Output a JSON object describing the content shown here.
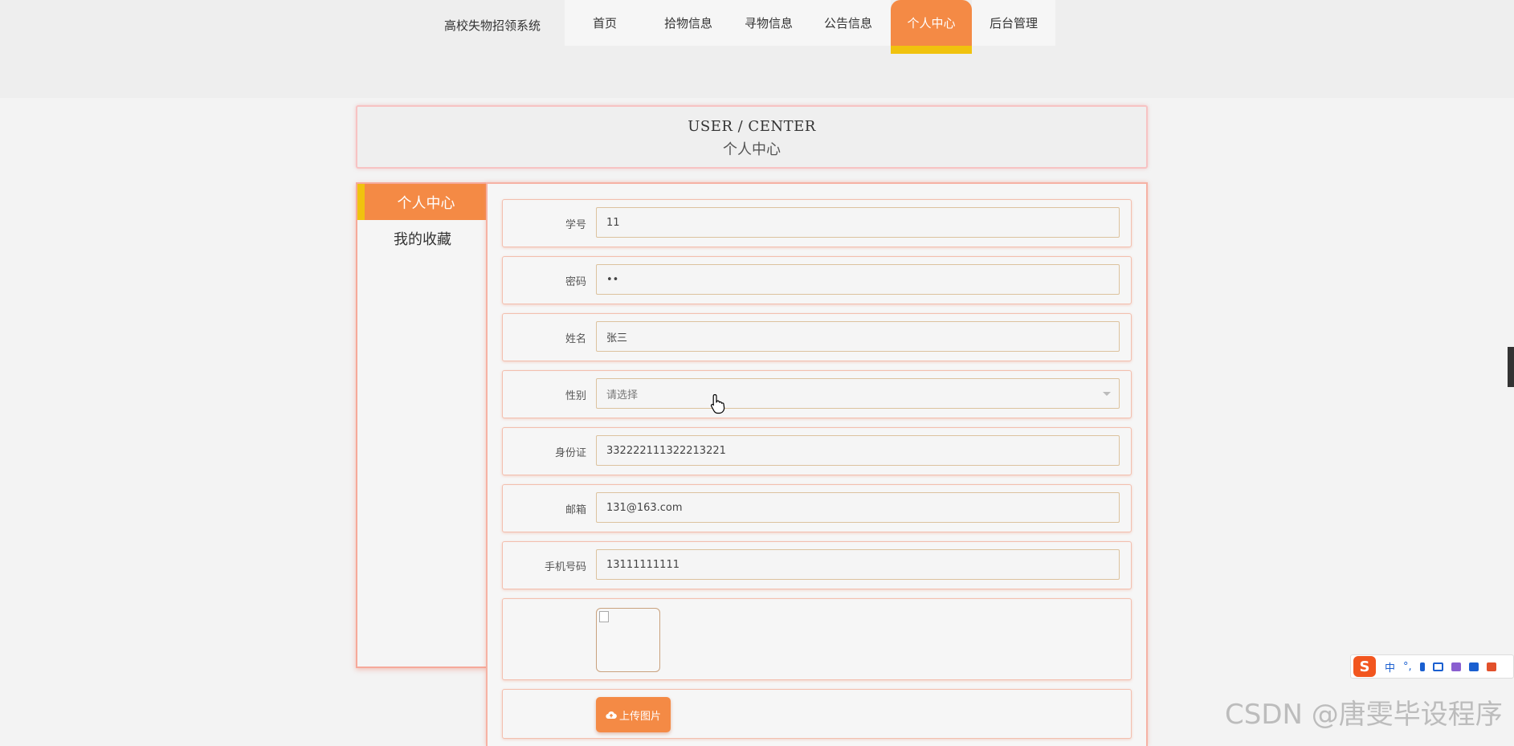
{
  "nav": {
    "site_title": "高校失物招领系统",
    "items": [
      {
        "label": "首页",
        "active": false
      },
      {
        "label": "拾物信息",
        "active": false
      },
      {
        "label": "寻物信息",
        "active": false
      },
      {
        "label": "公告信息",
        "active": false
      },
      {
        "label": "个人中心",
        "active": true
      },
      {
        "label": "后台管理",
        "active": false
      }
    ]
  },
  "header": {
    "title_en": "USER / CENTER",
    "title_zh": "个人中心"
  },
  "side_menu": {
    "items": [
      {
        "label": "个人中心",
        "active": true
      },
      {
        "label": "我的收藏",
        "active": false
      }
    ]
  },
  "form": {
    "student_id": {
      "label": "学号",
      "value": "11"
    },
    "password": {
      "label": "密码",
      "value": "••"
    },
    "name": {
      "label": "姓名",
      "value": "张三"
    },
    "gender": {
      "label": "性别",
      "value": "请选择"
    },
    "id_card": {
      "label": "身份证",
      "value": "332222111322213221"
    },
    "email": {
      "label": "邮箱",
      "value": "131@163.com"
    },
    "phone": {
      "label": "手机号码",
      "value": "13111111111"
    },
    "upload_label": "上传图片"
  },
  "ime": {
    "logo": "S",
    "mode": "中",
    "punct": "°,"
  },
  "watermark": "CSDN @唐雯毕设程序",
  "colors": {
    "accent": "#f48a45",
    "accent_bar": "#f0c20e",
    "border": "#f6b2a4"
  }
}
